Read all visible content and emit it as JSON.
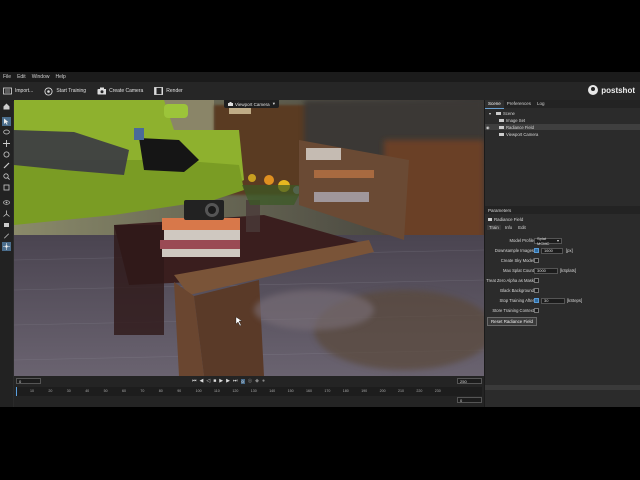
{
  "menu": [
    "File",
    "Edit",
    "Window",
    "Help"
  ],
  "toolbar": {
    "import_label": "Import...",
    "start_training_label": "Start Training",
    "create_camera_label": "Create Camera",
    "render_label": "Render"
  },
  "logo_text": "postshot",
  "viewport": {
    "tab_label": "Viewport Camera"
  },
  "timeline": {
    "current_frame": "0",
    "end_frame": "250",
    "bottom_value": "0",
    "frame_display": "0",
    "ticks": [
      "10",
      "20",
      "30",
      "40",
      "50",
      "60",
      "70",
      "80",
      "90",
      "100",
      "110",
      "120",
      "130",
      "140",
      "150",
      "160",
      "170",
      "180",
      "190",
      "200",
      "210",
      "220",
      "230"
    ]
  },
  "panel": {
    "tabs": [
      "Scene",
      "Preferences",
      "Log"
    ],
    "tree": [
      {
        "label": "Scene"
      },
      {
        "label": "Image Set"
      },
      {
        "label": "Radiance Field"
      },
      {
        "label": "Viewport Camera"
      }
    ],
    "params_title": "Parameters",
    "node_label": "Radiance Field",
    "sub_tabs": [
      "Train",
      "Info",
      "Edit"
    ],
    "model_profile_label": "Model Profile",
    "model_profile_value": "Splat MCMC",
    "downsample_label": "Downsample Images",
    "downsample_value": "1600",
    "downsample_unit": "[px]",
    "create_sky_label": "Create Sky Model",
    "max_splat_label": "Max Splat Count",
    "max_splat_value": "3000",
    "max_splat_unit": "[kSplats]",
    "treat_zero_label": "Treat Zero Alpha as Mask",
    "black_bg_label": "Black Background",
    "stop_training_label": "Stop Training After",
    "stop_training_value": "30",
    "stop_training_unit": "[kSteps]",
    "store_context_label": "Store Training Context",
    "reset_button": "Reset Radiance Field"
  },
  "colors": {
    "accent": "#4a8fd0",
    "panel": "#2b2b2b",
    "bar": "#1b1b1b"
  }
}
